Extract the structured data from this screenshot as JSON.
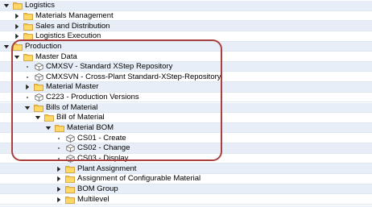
{
  "tree": {
    "rows": [
      {
        "label": "Logistics",
        "type": "folder",
        "state": "expanded",
        "level": 0
      },
      {
        "label": "Materials Management",
        "type": "folder",
        "state": "collapsed",
        "level": 1
      },
      {
        "label": "Sales and Distribution",
        "type": "folder",
        "state": "collapsed",
        "level": 1
      },
      {
        "label": "Logistics Execution",
        "type": "folder",
        "state": "collapsed",
        "level": 1
      },
      {
        "label": "Production",
        "type": "folder",
        "state": "expanded",
        "level": 0
      },
      {
        "label": "Master Data",
        "type": "folder",
        "state": "expanded",
        "level": 1
      },
      {
        "label": "CMXSV - Standard XStep Repository",
        "type": "transaction",
        "state": "leaf",
        "level": 2
      },
      {
        "label": "CMXSVN - Cross-Plant Standard-XStep-Repository",
        "type": "transaction",
        "state": "leaf",
        "level": 2
      },
      {
        "label": "Material Master",
        "type": "folder",
        "state": "collapsed",
        "level": 2
      },
      {
        "label": "C223 - Production Versions",
        "type": "transaction",
        "state": "leaf",
        "level": 2
      },
      {
        "label": "Bills of Material",
        "type": "folder",
        "state": "expanded",
        "level": 2
      },
      {
        "label": "Bill of Material",
        "type": "folder",
        "state": "expanded",
        "level": 3
      },
      {
        "label": "Material BOM",
        "type": "folder",
        "state": "expanded",
        "level": 4
      },
      {
        "label": "CS01 - Create",
        "type": "transaction",
        "state": "leaf",
        "level": 5
      },
      {
        "label": "CS02 - Change",
        "type": "transaction",
        "state": "leaf",
        "level": 5
      },
      {
        "label": "CS03 - Display",
        "type": "transaction",
        "state": "leaf",
        "level": 5
      },
      {
        "label": "Plant Assignment",
        "type": "folder",
        "state": "collapsed",
        "level": 5
      },
      {
        "label": "Assignment of Configurable Material",
        "type": "folder",
        "state": "collapsed",
        "level": 5
      },
      {
        "label": "BOM Group",
        "type": "folder",
        "state": "collapsed",
        "level": 5
      },
      {
        "label": "Multilevel",
        "type": "folder",
        "state": "collapsed",
        "level": 5
      }
    ]
  },
  "colors": {
    "row_alt": "#e7eef7",
    "folder_fill": "#f5c242",
    "folder_edge": "#c9922a",
    "highlight_border": "#a8403f"
  },
  "icons": {
    "folder": "folder-icon",
    "transaction": "transaction-cube-icon",
    "expanded": "triangle-down-icon",
    "collapsed": "triangle-right-icon",
    "leaf": "bullet-dot-icon"
  }
}
